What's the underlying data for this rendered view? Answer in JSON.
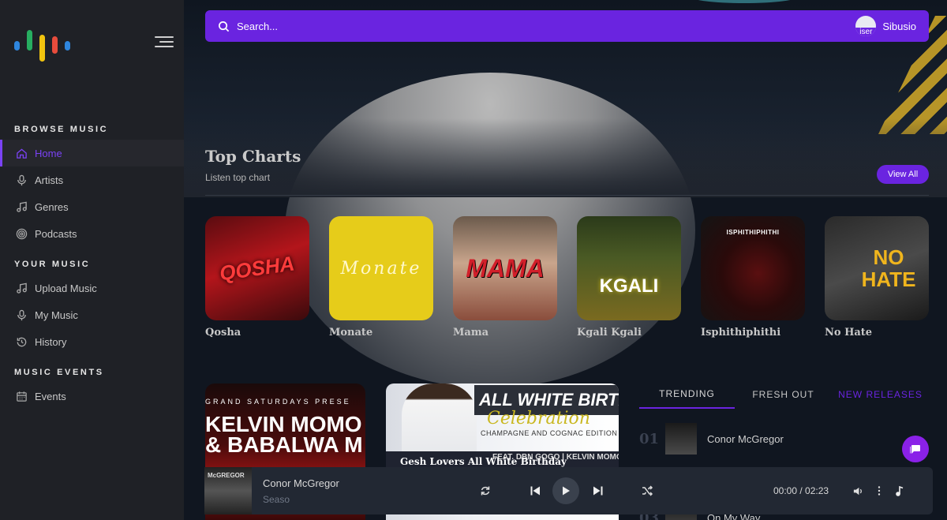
{
  "sidebar": {
    "sections": [
      {
        "title": "BROWSE MUSIC"
      },
      {
        "title": "YOUR MUSIC"
      },
      {
        "title": "MUSIC EVENTS"
      }
    ],
    "items": [
      {
        "label": "Home",
        "icon": "home-icon",
        "active": true
      },
      {
        "label": "Artists",
        "icon": "microphone-icon"
      },
      {
        "label": "Genres",
        "icon": "music-note-icon"
      },
      {
        "label": "Podcasts",
        "icon": "podcast-icon"
      },
      {
        "label": "Upload Music",
        "icon": "music-note-icon"
      },
      {
        "label": "My Music",
        "icon": "microphone-icon"
      },
      {
        "label": "History",
        "icon": "history-icon"
      },
      {
        "label": "Events",
        "icon": "calendar-icon"
      }
    ]
  },
  "search": {
    "placeholder": "Search..."
  },
  "user": {
    "name": "Sibusio",
    "avatar_alt": "iser"
  },
  "top_charts": {
    "title": "Top Charts",
    "subtitle": "Listen top chart",
    "view_all": "View All",
    "items": [
      {
        "title": "Qosha",
        "art_text": "QOSHA"
      },
      {
        "title": "Monate",
        "art_text": "Monate"
      },
      {
        "title": "Mama",
        "art_text": "MAMA"
      },
      {
        "title": "Kgali Kgali",
        "art_text": "KGALI"
      },
      {
        "title": "Isphithiphithi",
        "art_text": "ISPHITHIPHITHI"
      },
      {
        "title": "No Hate",
        "art_text": "NO HATE"
      }
    ]
  },
  "promos": [
    {
      "line1": "GRAND SATURDAYS PRESE",
      "line2": "KELVIN MOMO",
      "line3": "& BABALWA M"
    },
    {
      "head": "ALL WHITE BIRTHDAY",
      "script": "Celebration",
      "sub": "CHAMPAGNE AND COGNAC EDITION",
      "feat": "FEAT. DBN GOGO | KELVIN MOMO | JAZZIQ",
      "caption": "Gesh Lovers All White Birthday"
    }
  ],
  "tabs": [
    {
      "label": "TRENDING",
      "active": true
    },
    {
      "label": "FRESH OUT"
    },
    {
      "label": "NEW RELEASES"
    }
  ],
  "trending": [
    {
      "rank": "01",
      "name": "Conor McGregor"
    },
    {
      "rank": "03",
      "name": "On My Way"
    }
  ],
  "player": {
    "song": "Conor McGregor",
    "artist": "Seaso",
    "thumb_text": "McGREGOR",
    "time": "00:00 / 02:23"
  },
  "colors": {
    "accent": "#6a24e0",
    "active_nav": "#7b42f6",
    "sidebar_bg": "#1f2126",
    "main_bg": "#101620",
    "logo": [
      "#2e86de",
      "#27ae60",
      "#f1c40f",
      "#e74c3c",
      "#2e86de"
    ]
  }
}
